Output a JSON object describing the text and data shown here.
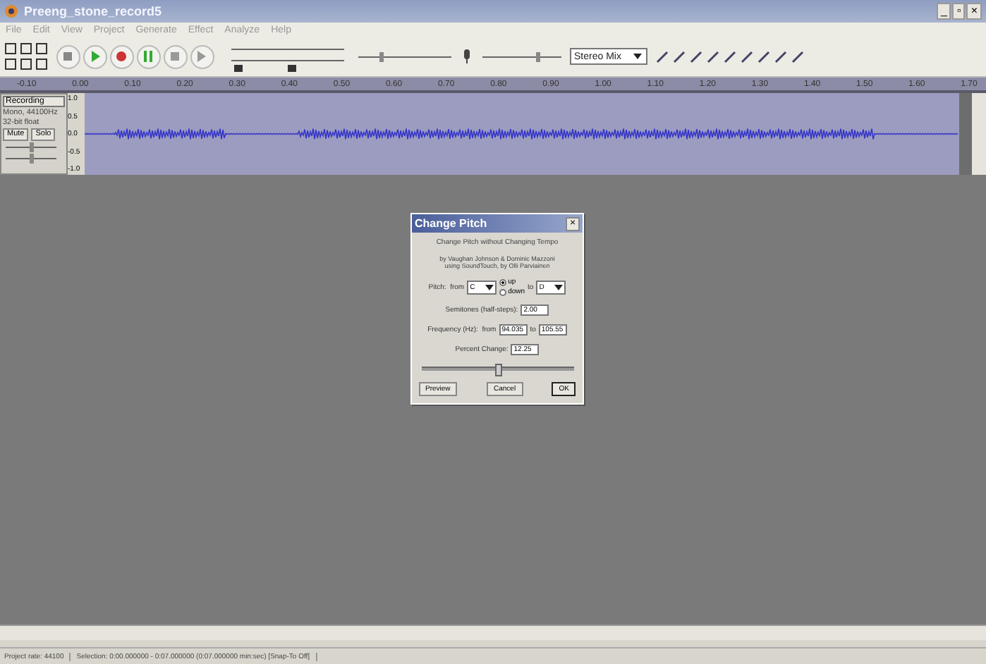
{
  "window": {
    "title": "Preeng_stone_record5",
    "controls": [
      "_",
      "▫",
      "×"
    ]
  },
  "menu": [
    "File",
    "Edit",
    "View",
    "Project",
    "Generate",
    "Effect",
    "Analyze",
    "Help"
  ],
  "volume_sliders": [
    {
      "level": 0.25
    },
    {
      "level": 0.7
    }
  ],
  "meter_select": {
    "value": "Stereo Mix"
  },
  "ruler": [
    "-0.10",
    "0.00",
    "0.10",
    "0.20",
    "0.30",
    "0.40",
    "0.50",
    "0.60",
    "0.70",
    "0.80",
    "0.90",
    "1.00",
    "1.10",
    "1.20",
    "1.30",
    "1.40",
    "1.50",
    "1.60",
    "1.70"
  ],
  "track": {
    "name": "Recording",
    "info": [
      "Mono, 44100Hz",
      "32-bit float"
    ],
    "buttons": [
      "Mute",
      "Solo"
    ],
    "gain": {
      "level": 0.5
    },
    "pan": {
      "level": 0.5
    },
    "scale": [
      "1.0",
      "0.5",
      "0.0",
      "-0.5",
      "-1.0"
    ]
  },
  "dialog": {
    "title": "Change Pitch",
    "close": "×",
    "heading": "Change Pitch without Changing Tempo",
    "credits": "by Vaughan Johnson & Dominic Mazzoni\nusing SoundTouch, by Olli Parviainen",
    "pitch": {
      "label": "Pitch:  from",
      "from": "C",
      "to_label": "to",
      "to": "D",
      "directions": [
        {
          "label": "up",
          "selected": true
        },
        {
          "label": "down",
          "selected": false
        }
      ]
    },
    "semitones": {
      "label": "Semitones (half-steps):",
      "value": "2.00"
    },
    "frequency": {
      "label": "Frequency (Hz):  from",
      "from": "94.035",
      "to_label": "to",
      "to": "105.55"
    },
    "percent": {
      "label": "Percent Change:",
      "value": "12.25"
    },
    "slider": {
      "level": 0.5
    },
    "buttons": [
      {
        "label": "Preview",
        "default": false
      },
      {
        "label": "Cancel",
        "default": false
      },
      {
        "label": "OK",
        "default": true
      }
    ]
  },
  "status_bar": [
    "Project rate: 44100",
    "Selection: 0:00.000000 - 0:07.000000 (0:07.000000 min:sec)  [Snap-To Off]"
  ]
}
